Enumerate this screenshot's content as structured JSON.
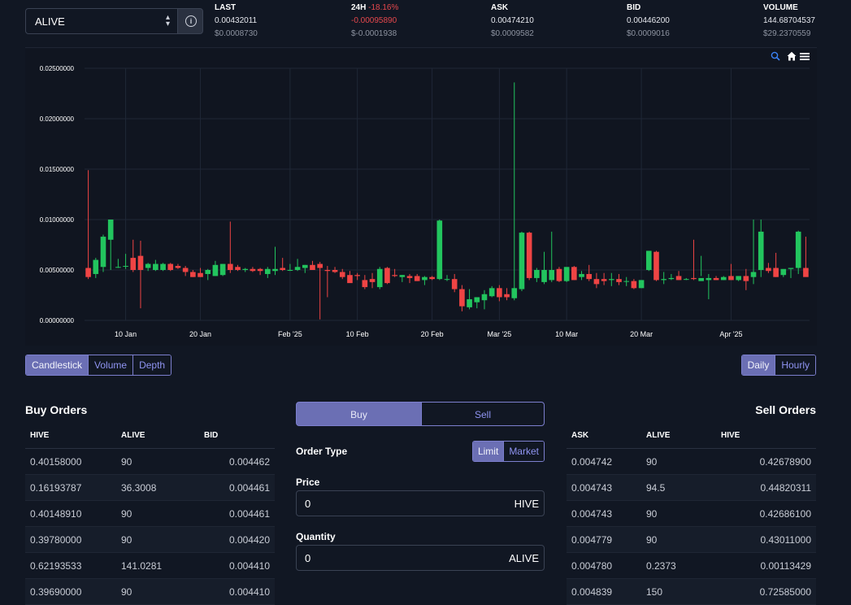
{
  "token_select": {
    "value": "ALIVE"
  },
  "stats": [
    {
      "label": "LAST",
      "change": "",
      "value": "0.00432011",
      "usd": "$0.0008730"
    },
    {
      "label": "24H",
      "change": "-18.16%",
      "value": "-0.00095890",
      "usd": "$-0.0001938"
    },
    {
      "label": "ASK",
      "change": "",
      "value": "0.00474210",
      "usd": "$0.0009582"
    },
    {
      "label": "BID",
      "change": "",
      "value": "0.00446200",
      "usd": "$0.0009016"
    },
    {
      "label": "VOLUME",
      "change": "",
      "value": "144.68704537",
      "usd": "$29.2370559"
    }
  ],
  "colors": {
    "up": "#22c55e",
    "down": "#ef4444",
    "accent": "#6b6fb4",
    "accent_text": "#8f94f2",
    "background": "#111723"
  },
  "chart_toolbar": [
    "zoom-icon",
    "home-icon",
    "menu-icon"
  ],
  "chart_data": {
    "type": "candlestick",
    "y_ticks": [
      "0.02500000",
      "0.02000000",
      "0.01500000",
      "0.01000000",
      "0.00500000",
      "0.00000000"
    ],
    "ylim": [
      0,
      0.025
    ],
    "x_ticks": [
      "10 Jan",
      "20 Jan",
      "Feb '25",
      "10 Feb",
      "20 Feb",
      "Mar '25",
      "10 Mar",
      "20 Mar",
      "Apr '25"
    ],
    "xlim": [
      "2025-01-05",
      "2025-04-11"
    ],
    "grid": true,
    "candles": [
      {
        "d": "2025-01-05",
        "o": 0.0052,
        "h": 0.0149,
        "l": 0.0041,
        "c": 0.0043
      },
      {
        "d": "2025-01-06",
        "o": 0.0046,
        "h": 0.0062,
        "l": 0.0042,
        "c": 0.006
      },
      {
        "d": "2025-01-07",
        "o": 0.0053,
        "h": 0.0085,
        "l": 0.0048,
        "c": 0.0083
      },
      {
        "d": "2025-01-08",
        "o": 0.008,
        "h": 0.01,
        "l": 0.005,
        "c": 0.01
      },
      {
        "d": "2025-01-09",
        "o": 0.0053,
        "h": 0.0061,
        "l": 0.0052,
        "c": 0.0053
      },
      {
        "d": "2025-01-10",
        "o": 0.0054,
        "h": 0.0066,
        "l": 0.0051,
        "c": 0.0054
      },
      {
        "d": "2025-01-11",
        "o": 0.0062,
        "h": 0.008,
        "l": 0.0048,
        "c": 0.005
      },
      {
        "d": "2025-01-12",
        "o": 0.0064,
        "h": 0.0079,
        "l": 0.0012,
        "c": 0.005
      },
      {
        "d": "2025-01-13",
        "o": 0.0052,
        "h": 0.0057,
        "l": 0.0049,
        "c": 0.0056
      },
      {
        "d": "2025-01-14",
        "o": 0.005,
        "h": 0.006,
        "l": 0.0049,
        "c": 0.0056
      },
      {
        "d": "2025-01-15",
        "o": 0.005,
        "h": 0.0057,
        "l": 0.0049,
        "c": 0.0056
      },
      {
        "d": "2025-01-16",
        "o": 0.0056,
        "h": 0.0057,
        "l": 0.0049,
        "c": 0.005
      },
      {
        "d": "2025-01-17",
        "o": 0.0054,
        "h": 0.0056,
        "l": 0.0051,
        "c": 0.0052
      },
      {
        "d": "2025-01-18",
        "o": 0.0052,
        "h": 0.0054,
        "l": 0.0044,
        "c": 0.0048
      },
      {
        "d": "2025-01-19",
        "o": 0.0048,
        "h": 0.005,
        "l": 0.0043,
        "c": 0.0043
      },
      {
        "d": "2025-01-20",
        "o": 0.0047,
        "h": 0.0052,
        "l": 0.0043,
        "c": 0.0043
      },
      {
        "d": "2025-01-21",
        "o": 0.0046,
        "h": 0.0051,
        "l": 0.004,
        "c": 0.005
      },
      {
        "d": "2025-01-22",
        "o": 0.0044,
        "h": 0.0059,
        "l": 0.0044,
        "c": 0.0055
      },
      {
        "d": "2025-01-23",
        "o": 0.0045,
        "h": 0.0056,
        "l": 0.0044,
        "c": 0.0056
      },
      {
        "d": "2025-01-24",
        "o": 0.0056,
        "h": 0.0098,
        "l": 0.0047,
        "c": 0.005
      },
      {
        "d": "2025-01-25",
        "o": 0.0053,
        "h": 0.0055,
        "l": 0.0049,
        "c": 0.005
      },
      {
        "d": "2025-01-26",
        "o": 0.005,
        "h": 0.0052,
        "l": 0.0048,
        "c": 0.0051
      },
      {
        "d": "2025-01-27",
        "o": 0.0051,
        "h": 0.0053,
        "l": 0.0048,
        "c": 0.0049
      },
      {
        "d": "2025-01-28",
        "o": 0.0051,
        "h": 0.0052,
        "l": 0.0045,
        "c": 0.0049
      },
      {
        "d": "2025-01-29",
        "o": 0.0046,
        "h": 0.0053,
        "l": 0.0042,
        "c": 0.0051
      },
      {
        "d": "2025-01-30",
        "o": 0.0049,
        "h": 0.0073,
        "l": 0.0045,
        "c": 0.0051
      },
      {
        "d": "2025-01-31",
        "o": 0.0052,
        "h": 0.0062,
        "l": 0.0049,
        "c": 0.005
      },
      {
        "d": "2025-02-01",
        "o": 0.005,
        "h": 0.0056,
        "l": 0.0049,
        "c": 0.005
      },
      {
        "d": "2025-02-02",
        "o": 0.005,
        "h": 0.0061,
        "l": 0.0049,
        "c": 0.0053
      },
      {
        "d": "2025-02-03",
        "o": 0.0052,
        "h": 0.0055,
        "l": 0.0047,
        "c": 0.0055
      },
      {
        "d": "2025-02-04",
        "o": 0.0055,
        "h": 0.0059,
        "l": 0.005,
        "c": 0.005
      },
      {
        "d": "2025-02-05",
        "o": 0.0056,
        "h": 0.0058,
        "l": 0.0001,
        "c": 0.0052
      },
      {
        "d": "2025-02-06",
        "o": 0.005,
        "h": 0.0054,
        "l": 0.0023,
        "c": 0.0049
      },
      {
        "d": "2025-02-07",
        "o": 0.005,
        "h": 0.0053,
        "l": 0.0047,
        "c": 0.0048
      },
      {
        "d": "2025-02-08",
        "o": 0.0048,
        "h": 0.0051,
        "l": 0.0041,
        "c": 0.0043
      },
      {
        "d": "2025-02-09",
        "o": 0.0045,
        "h": 0.0049,
        "l": 0.0039,
        "c": 0.0037
      },
      {
        "d": "2025-02-10",
        "o": 0.0045,
        "h": 0.0047,
        "l": 0.004,
        "c": 0.0044
      },
      {
        "d": "2025-02-11",
        "o": 0.004,
        "h": 0.0045,
        "l": 0.0031,
        "c": 0.0033
      },
      {
        "d": "2025-02-12",
        "o": 0.0041,
        "h": 0.0047,
        "l": 0.0032,
        "c": 0.0038
      },
      {
        "d": "2025-02-13",
        "o": 0.0033,
        "h": 0.0053,
        "l": 0.0031,
        "c": 0.0051
      },
      {
        "d": "2025-02-14",
        "o": 0.0052,
        "h": 0.0053,
        "l": 0.0036,
        "c": 0.0037
      },
      {
        "d": "2025-02-15",
        "o": 0.0045,
        "h": 0.0051,
        "l": 0.0043,
        "c": 0.0044
      },
      {
        "d": "2025-02-16",
        "o": 0.0043,
        "h": 0.0045,
        "l": 0.0038,
        "c": 0.0045
      },
      {
        "d": "2025-02-17",
        "o": 0.0044,
        "h": 0.0046,
        "l": 0.0037,
        "c": 0.0042
      },
      {
        "d": "2025-02-18",
        "o": 0.0044,
        "h": 0.0046,
        "l": 0.0039,
        "c": 0.0039
      },
      {
        "d": "2025-02-19",
        "o": 0.004,
        "h": 0.0044,
        "l": 0.0035,
        "c": 0.0043
      },
      {
        "d": "2025-02-20",
        "o": 0.0043,
        "h": 0.0044,
        "l": 0.004,
        "c": 0.0041
      },
      {
        "d": "2025-02-21",
        "o": 0.0041,
        "h": 0.01,
        "l": 0.004,
        "c": 0.0099
      },
      {
        "d": "2025-02-22",
        "o": 0.0041,
        "h": 0.0045,
        "l": 0.0039,
        "c": 0.0041
      },
      {
        "d": "2025-02-23",
        "o": 0.0041,
        "h": 0.0046,
        "l": 0.0028,
        "c": 0.0031
      },
      {
        "d": "2025-02-24",
        "o": 0.0031,
        "h": 0.0035,
        "l": 0.0009,
        "c": 0.0014
      },
      {
        "d": "2025-02-25",
        "o": 0.0013,
        "h": 0.0031,
        "l": 0.0011,
        "c": 0.0021
      },
      {
        "d": "2025-02-26",
        "o": 0.0018,
        "h": 0.0023,
        "l": 0.0012,
        "c": 0.0023
      },
      {
        "d": "2025-02-27",
        "o": 0.002,
        "h": 0.003,
        "l": 0.0011,
        "c": 0.0026
      },
      {
        "d": "2025-02-28",
        "o": 0.0024,
        "h": 0.0034,
        "l": 0.0023,
        "c": 0.0032
      },
      {
        "d": "2025-03-01",
        "o": 0.0032,
        "h": 0.0035,
        "l": 0.0019,
        "c": 0.0023
      },
      {
        "d": "2025-03-02",
        "o": 0.0026,
        "h": 0.0032,
        "l": 0.002,
        "c": 0.0023
      },
      {
        "d": "2025-03-03",
        "o": 0.0022,
        "h": 0.0236,
        "l": 0.002,
        "c": 0.0032
      },
      {
        "d": "2025-03-04",
        "o": 0.0031,
        "h": 0.0088,
        "l": 0.0029,
        "c": 0.0087
      },
      {
        "d": "2025-03-05",
        "o": 0.0087,
        "h": 0.0088,
        "l": 0.004,
        "c": 0.0042
      },
      {
        "d": "2025-03-06",
        "o": 0.0042,
        "h": 0.0052,
        "l": 0.0038,
        "c": 0.005
      },
      {
        "d": "2025-03-07",
        "o": 0.0038,
        "h": 0.0068,
        "l": 0.0036,
        "c": 0.005
      },
      {
        "d": "2025-03-08",
        "o": 0.004,
        "h": 0.0088,
        "l": 0.0038,
        "c": 0.005
      },
      {
        "d": "2025-03-09",
        "o": 0.0051,
        "h": 0.0053,
        "l": 0.0038,
        "c": 0.0039
      },
      {
        "d": "2025-03-10",
        "o": 0.0039,
        "h": 0.0043,
        "l": 0.0038,
        "c": 0.0053
      },
      {
        "d": "2025-03-11",
        "o": 0.0053,
        "h": 0.0054,
        "l": 0.004,
        "c": 0.004
      },
      {
        "d": "2025-03-12",
        "o": 0.0043,
        "h": 0.0049,
        "l": 0.004,
        "c": 0.0046
      },
      {
        "d": "2025-03-13",
        "o": 0.0046,
        "h": 0.0055,
        "l": 0.0039,
        "c": 0.0041
      },
      {
        "d": "2025-03-14",
        "o": 0.0041,
        "h": 0.0047,
        "l": 0.0032,
        "c": 0.0036
      },
      {
        "d": "2025-03-15",
        "o": 0.0041,
        "h": 0.0047,
        "l": 0.0035,
        "c": 0.0039
      },
      {
        "d": "2025-03-16",
        "o": 0.004,
        "h": 0.0047,
        "l": 0.0034,
        "c": 0.0041
      },
      {
        "d": "2025-03-17",
        "o": 0.0041,
        "h": 0.0046,
        "l": 0.0035,
        "c": 0.0038
      },
      {
        "d": "2025-03-18",
        "o": 0.0039,
        "h": 0.0043,
        "l": 0.0034,
        "c": 0.0039
      },
      {
        "d": "2025-03-19",
        "o": 0.0039,
        "h": 0.0041,
        "l": 0.0031,
        "c": 0.0032
      },
      {
        "d": "2025-03-20",
        "o": 0.0032,
        "h": 0.004,
        "l": 0.0032,
        "c": 0.004
      },
      {
        "d": "2025-03-21",
        "o": 0.005,
        "h": 0.0069,
        "l": 0.0049,
        "c": 0.0069
      },
      {
        "d": "2025-03-22",
        "o": 0.0068,
        "h": 0.0069,
        "l": 0.0039,
        "c": 0.004
      },
      {
        "d": "2025-03-23",
        "o": 0.004,
        "h": 0.0048,
        "l": 0.0036,
        "c": 0.0041
      },
      {
        "d": "2025-03-24",
        "o": 0.0041,
        "h": 0.0046,
        "l": 0.004,
        "c": 0.0042
      },
      {
        "d": "2025-03-25",
        "o": 0.0044,
        "h": 0.0049,
        "l": 0.004,
        "c": 0.004
      },
      {
        "d": "2025-03-26",
        "o": 0.0041,
        "h": 0.0042,
        "l": 0.004,
        "c": 0.0041
      },
      {
        "d": "2025-03-27",
        "o": 0.0042,
        "h": 0.008,
        "l": 0.004,
        "c": 0.0041
      },
      {
        "d": "2025-03-28",
        "o": 0.0039,
        "h": 0.0064,
        "l": 0.0044,
        "c": 0.0042
      },
      {
        "d": "2025-03-29",
        "o": 0.004,
        "h": 0.0046,
        "l": 0.0021,
        "c": 0.0042
      },
      {
        "d": "2025-03-30",
        "o": 0.0042,
        "h": 0.0044,
        "l": 0.004,
        "c": 0.004
      },
      {
        "d": "2025-03-31",
        "o": 0.004,
        "h": 0.0044,
        "l": 0.004,
        "c": 0.0043
      },
      {
        "d": "2025-04-01",
        "o": 0.0044,
        "h": 0.0056,
        "l": 0.004,
        "c": 0.004
      },
      {
        "d": "2025-04-02",
        "o": 0.004,
        "h": 0.0044,
        "l": 0.0039,
        "c": 0.0044
      },
      {
        "d": "2025-04-03",
        "o": 0.0044,
        "h": 0.0051,
        "l": 0.003,
        "c": 0.0039
      },
      {
        "d": "2025-04-04",
        "o": 0.0043,
        "h": 0.01,
        "l": 0.0036,
        "c": 0.0048
      },
      {
        "d": "2025-04-05",
        "o": 0.005,
        "h": 0.01,
        "l": 0.0043,
        "c": 0.0088
      },
      {
        "d": "2025-04-06",
        "o": 0.0052,
        "h": 0.0057,
        "l": 0.0047,
        "c": 0.0049
      },
      {
        "d": "2025-04-07",
        "o": 0.0052,
        "h": 0.0067,
        "l": 0.0043,
        "c": 0.0043
      },
      {
        "d": "2025-04-08",
        "o": 0.0045,
        "h": 0.005,
        "l": 0.0043,
        "c": 0.0051
      },
      {
        "d": "2025-04-09",
        "o": 0.0051,
        "h": 0.0052,
        "l": 0.0042,
        "c": 0.0052
      },
      {
        "d": "2025-04-10",
        "o": 0.0052,
        "h": 0.0089,
        "l": 0.0046,
        "c": 0.0088
      },
      {
        "d": "2025-04-11",
        "o": 0.0052,
        "h": 0.0083,
        "l": 0.0045,
        "c": 0.0043
      }
    ]
  },
  "chart_tabs": [
    "Candlestick",
    "Volume",
    "Depth"
  ],
  "interval_tabs": [
    "Daily",
    "Hourly"
  ],
  "buy_orders": {
    "title": "Buy Orders",
    "headers": [
      "HIVE",
      "ALIVE",
      "BID"
    ],
    "rows": [
      [
        "0.40158000",
        "90",
        "0.004462"
      ],
      [
        "0.16193787",
        "36.3008",
        "0.004461"
      ],
      [
        "0.40148910",
        "90",
        "0.004461"
      ],
      [
        "0.39780000",
        "90",
        "0.004420"
      ],
      [
        "0.62193533",
        "141.0281",
        "0.004410"
      ],
      [
        "0.39690000",
        "90",
        "0.004410"
      ]
    ]
  },
  "sell_orders": {
    "title": "Sell Orders",
    "headers": [
      "ASK",
      "ALIVE",
      "HIVE"
    ],
    "rows": [
      [
        "0.004742",
        "90",
        "0.42678900"
      ],
      [
        "0.004743",
        "94.5",
        "0.44820311"
      ],
      [
        "0.004743",
        "90",
        "0.42686100"
      ],
      [
        "0.004779",
        "90",
        "0.43011000"
      ],
      [
        "0.004780",
        "0.2373",
        "0.00113429"
      ],
      [
        "0.004839",
        "150",
        "0.72585000"
      ]
    ]
  },
  "trade_form": {
    "buy_label": "Buy",
    "sell_label": "Sell",
    "order_type_label": "Order Type",
    "order_types": [
      "Limit",
      "Market"
    ],
    "price_label": "Price",
    "price_value": "0",
    "price_unit": "HIVE",
    "quantity_label": "Quantity",
    "quantity_value": "0",
    "quantity_unit": "ALIVE"
  }
}
